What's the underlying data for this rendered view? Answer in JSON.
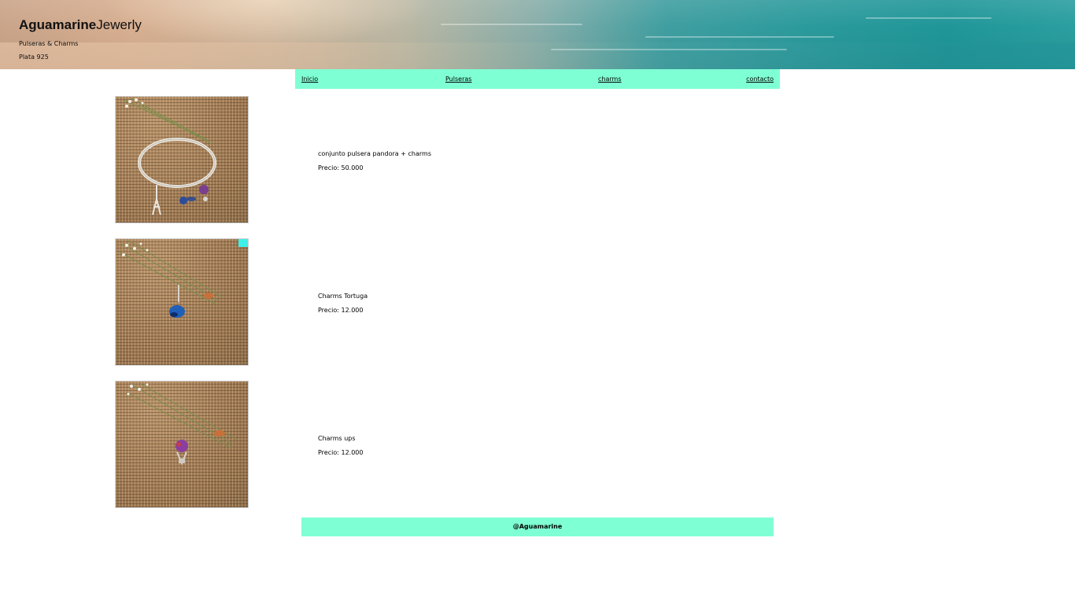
{
  "header": {
    "brand_bold": "Aguamarine",
    "brand_light": "Jewerly",
    "tagline_1": "Pulseras & Charms",
    "tagline_2": "Plata 925"
  },
  "nav": {
    "items": [
      {
        "label": "Inicio"
      },
      {
        "label": "Pulseras"
      },
      {
        "label": "charms"
      },
      {
        "label": "contacto"
      }
    ],
    "background": "#7fffd4"
  },
  "products": [
    {
      "name": "conjunto pulsera pandora + charms",
      "price": "Precio: 50.000",
      "photo_icon": "bracelet-photo"
    },
    {
      "name": "Charms Tortuga",
      "price": "Precio: 12.000",
      "photo_icon": "turtle-charm-photo"
    },
    {
      "name": "Charms ups",
      "price": "Precio: 12.000",
      "photo_icon": "balloon-charm-photo"
    }
  ],
  "footer": {
    "text": "@Aguamarine",
    "background": "#7fffd4"
  }
}
